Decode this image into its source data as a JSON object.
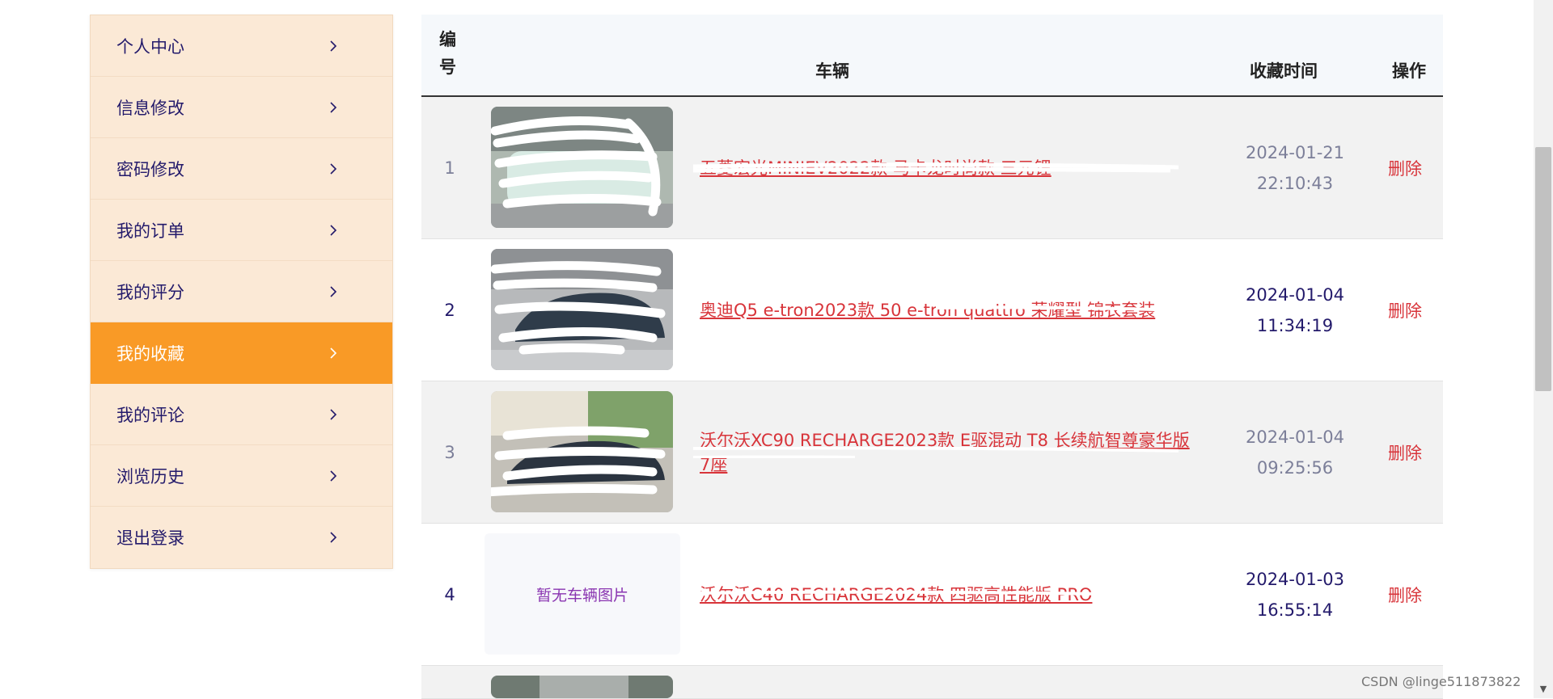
{
  "sidebar": {
    "items": [
      {
        "label": "个人中心"
      },
      {
        "label": "信息修改"
      },
      {
        "label": "密码修改"
      },
      {
        "label": "我的订单"
      },
      {
        "label": "我的评分"
      },
      {
        "label": "我的收藏"
      },
      {
        "label": "我的评论"
      },
      {
        "label": "浏览历史"
      },
      {
        "label": "退出登录"
      }
    ],
    "active_index": 5
  },
  "table": {
    "headers": {
      "no": "编号",
      "car": "车辆",
      "time": "收藏时间",
      "op": "操作"
    },
    "rows": [
      {
        "no": "1",
        "car": "五菱宏光MINIEV2022款 马卡龙时尚款 三元锂",
        "date": "2024-01-21",
        "time": "22:10:43",
        "op": "删除"
      },
      {
        "no": "2",
        "car": "奥迪Q5 e-tron2023款 50 e-tron quattro 荣耀型 锦衣套装",
        "date": "2024-01-04",
        "time": "11:34:19",
        "op": "删除"
      },
      {
        "no": "3",
        "car": "沃尔沃XC90 RECHARGE2023款 E驱混动 T8 长续航智尊豪华版 7座",
        "date": "2024-01-04",
        "time": "09:25:56",
        "op": "删除"
      },
      {
        "no": "4",
        "car": "沃尔沃C40 RECHARGE2024款 四驱高性能版 PRO",
        "date": "2024-01-03",
        "time": "16:55:14",
        "op": "删除",
        "no_image_label": "暂无车辆图片"
      }
    ]
  },
  "watermark": "CSDN @linge511873822",
  "colors": {
    "sidebar_bg": "#fbe9d6",
    "sidebar_active": "#f99a26",
    "link_red": "#d8343a",
    "nav_text": "#231a6b"
  }
}
